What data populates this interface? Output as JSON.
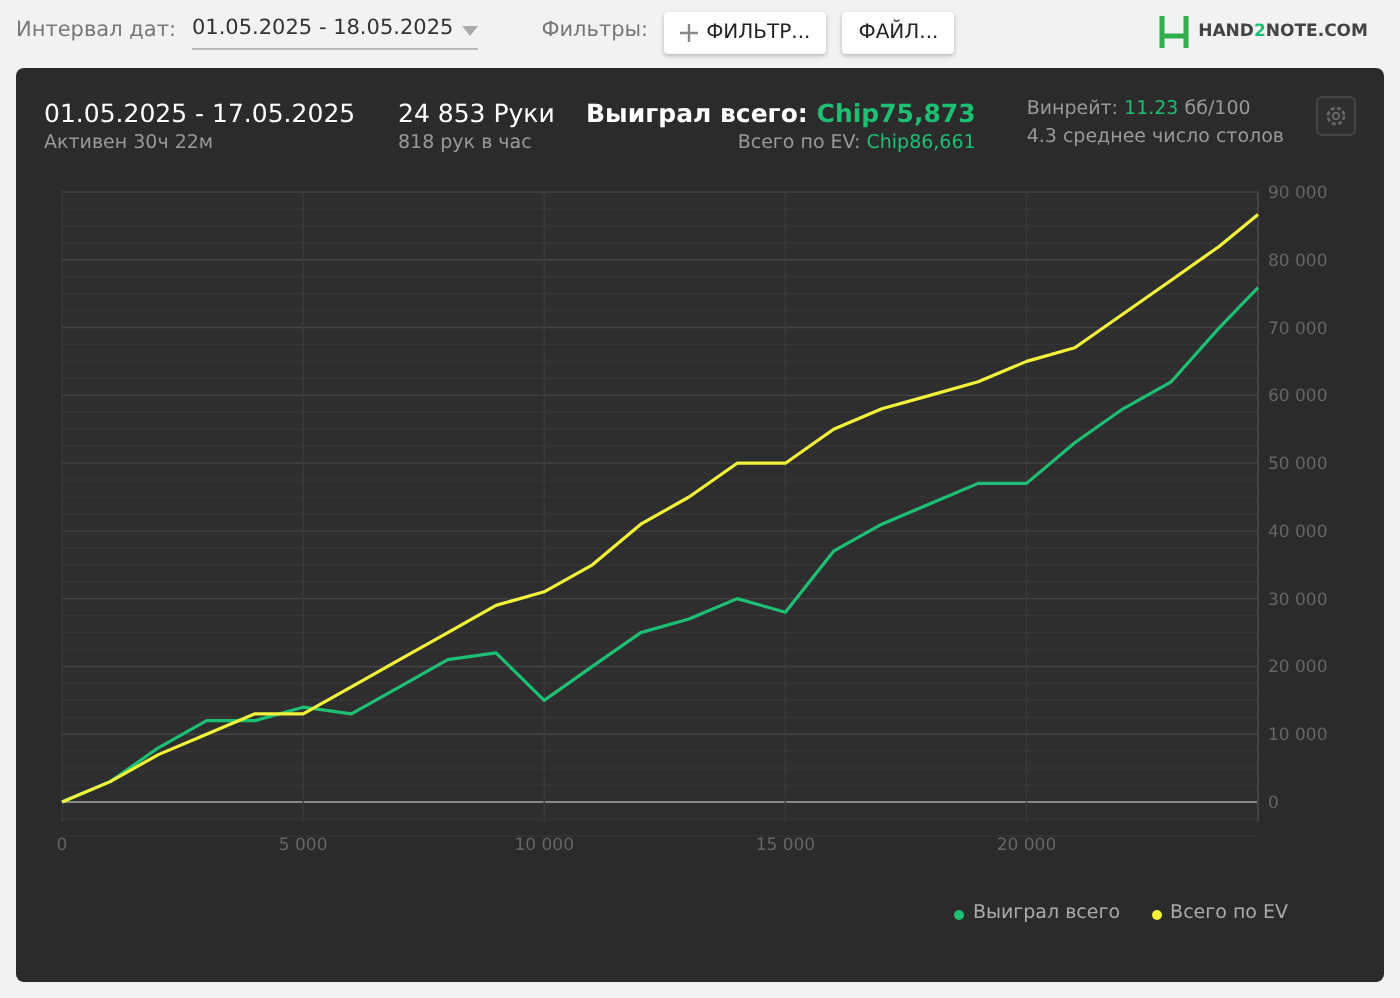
{
  "toolbar": {
    "date_label": "Интервал дат:",
    "date_range": "01.05.2025 - 18.05.2025",
    "filters_label": "Фильтры:",
    "filter_button": "ФИЛЬТР...",
    "file_button": "ФАЙЛ...",
    "logo_parts": [
      "HAND",
      "2",
      "NOTE.COM"
    ]
  },
  "summary": {
    "period": "01.05.2025 - 17.05.2025",
    "active": "Активен 30ч 22м",
    "hands": "24 853 Руки",
    "hands_per_hour": "818 рук в час",
    "won_label": "Выиграл всего:",
    "won_value": "Chip75,873",
    "ev_label": "Всего по EV:",
    "ev_value": "Chip86,661",
    "winrate_label": "Винрейт:",
    "winrate_value": "11.23",
    "winrate_unit": "бб/100",
    "tables": "4.3 среднее число столов"
  },
  "chart_data": {
    "type": "line",
    "x": [
      0,
      1000,
      2000,
      3000,
      4000,
      5000,
      6000,
      7000,
      8000,
      9000,
      10000,
      11000,
      12000,
      13000,
      14000,
      15000,
      16000,
      17000,
      18000,
      19000,
      20000,
      21000,
      22000,
      23000,
      24000,
      24800
    ],
    "series": [
      {
        "name": "Выиграл всего",
        "color": "#1dbf73",
        "values": [
          0,
          3000,
          8000,
          12000,
          12000,
          14000,
          13000,
          17000,
          21000,
          22000,
          15000,
          20000,
          25000,
          27000,
          30000,
          28000,
          37000,
          41000,
          44000,
          47000,
          47000,
          53000,
          58000,
          62000,
          70000,
          75900
        ]
      },
      {
        "name": "Всего по EV",
        "color": "#f2f23a",
        "values": [
          0,
          3000,
          7000,
          10000,
          13000,
          13000,
          17000,
          21000,
          25000,
          29000,
          31000,
          35000,
          41000,
          45000,
          50000,
          50000,
          55000,
          58000,
          60000,
          62000,
          65000,
          67000,
          72000,
          77000,
          82000,
          86700
        ]
      }
    ],
    "grid": true,
    "xlim": [
      0,
      24800
    ],
    "ylim": [
      0,
      90000
    ],
    "xticks": [
      {
        "value": 0,
        "label": "0"
      },
      {
        "value": 5000,
        "label": "5 000"
      },
      {
        "value": 10000,
        "label": "10 000"
      },
      {
        "value": 15000,
        "label": "15 000"
      },
      {
        "value": 20000,
        "label": "20 000"
      }
    ],
    "yticks": [
      {
        "value": 0,
        "label": "0"
      },
      {
        "value": 10000,
        "label": "10 000"
      },
      {
        "value": 20000,
        "label": "20 000"
      },
      {
        "value": 30000,
        "label": "30 000"
      },
      {
        "value": 40000,
        "label": "40 000"
      },
      {
        "value": 50000,
        "label": "50 000"
      },
      {
        "value": 60000,
        "label": "60 000"
      },
      {
        "value": 70000,
        "label": "70 000"
      },
      {
        "value": 80000,
        "label": "80 000"
      },
      {
        "value": 90000,
        "label": "90 000"
      }
    ]
  }
}
